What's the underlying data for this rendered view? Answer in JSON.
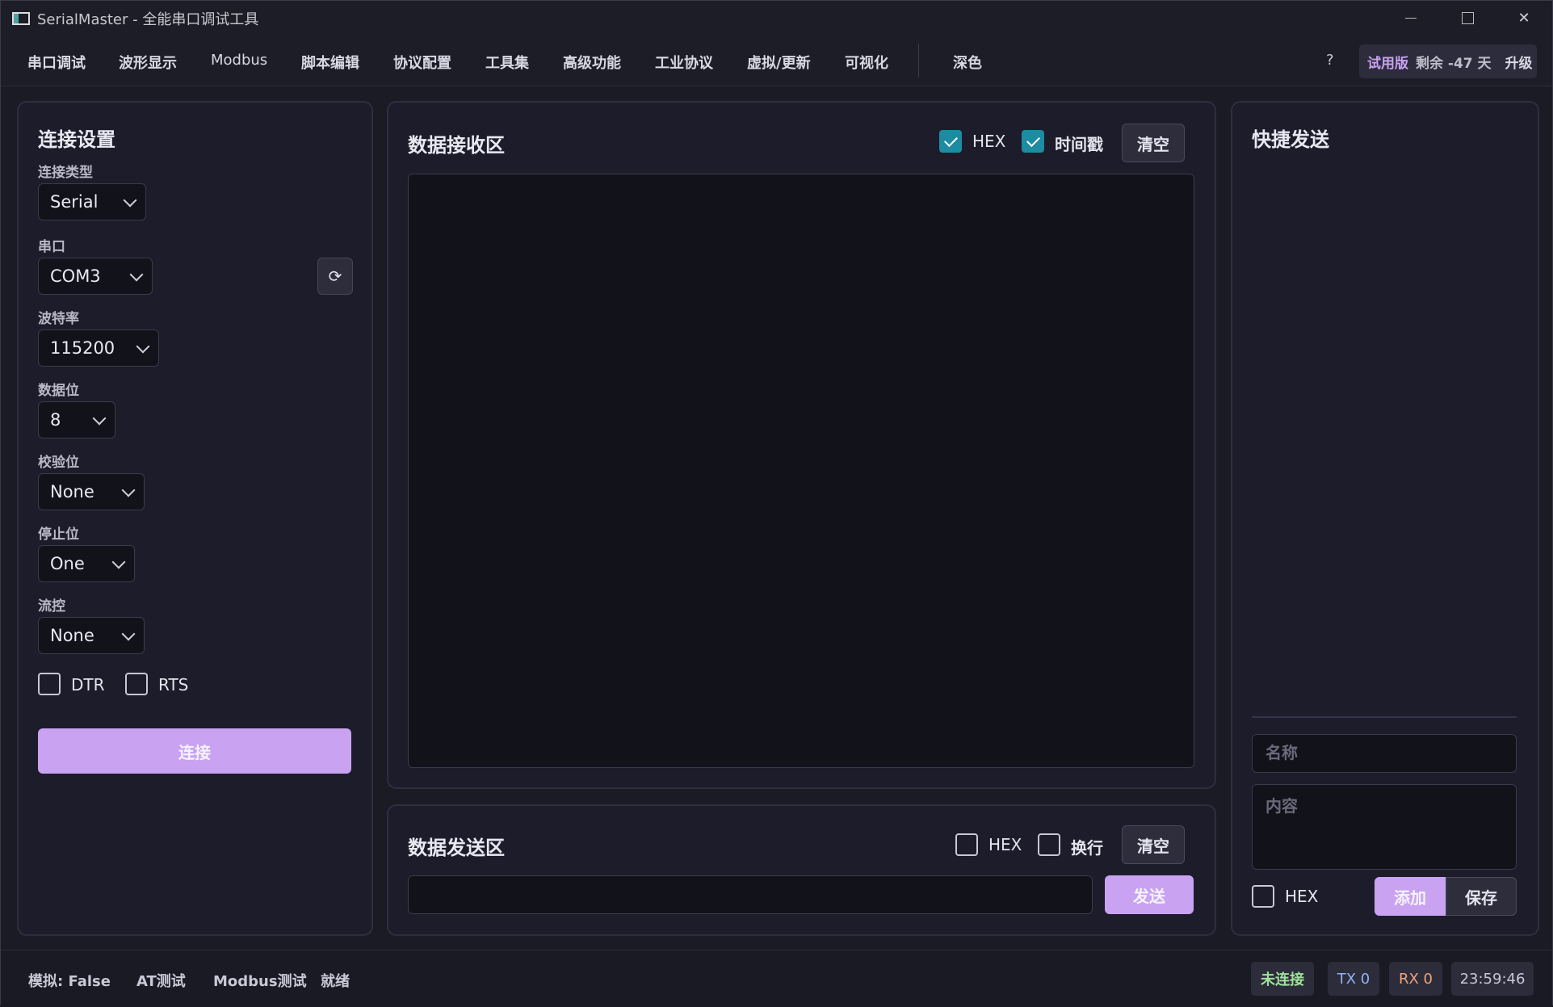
{
  "window": {
    "title": "SerialMaster - 全能串口调试工具"
  },
  "menu": {
    "items": [
      "串口调试",
      "波形显示",
      "Modbus",
      "脚本编辑",
      "协议配置",
      "工具集",
      "高级功能",
      "工业协议",
      "虚拟/更新",
      "可视化"
    ],
    "theme": "深色",
    "help": "?",
    "trial_label": "试用版",
    "trial_days": "剩余 -47 天",
    "upgrade": "升级"
  },
  "connection": {
    "title": "连接设置",
    "type_label": "连接类型",
    "type_value": "Serial",
    "port_label": "串口",
    "port_value": "COM3",
    "refresh_icon": "⟳",
    "baud_label": "波特率",
    "baud_value": "115200",
    "databits_label": "数据位",
    "databits_value": "8",
    "parity_label": "校验位",
    "parity_value": "None",
    "stopbits_label": "停止位",
    "stopbits_value": "One",
    "flow_label": "流控",
    "flow_value": "None",
    "dtr_label": "DTR",
    "rts_label": "RTS",
    "connect_label": "连接"
  },
  "receive": {
    "title": "数据接收区",
    "hex_label": "HEX",
    "hex_checked": true,
    "timestamp_label": "时间戳",
    "timestamp_checked": true,
    "clear_label": "清空"
  },
  "send": {
    "title": "数据发送区",
    "hex_label": "HEX",
    "newline_label": "换行",
    "clear_label": "清空",
    "send_label": "发送"
  },
  "quicksend": {
    "title": "快捷发送",
    "name_placeholder": "名称",
    "content_placeholder": "内容",
    "hex_label": "HEX",
    "add_label": "添加",
    "save_label": "保存"
  },
  "status": {
    "sim": "模拟: False",
    "at_test": "AT测试",
    "modbus_test": "Modbus测试",
    "ready": "就绪",
    "conn_state": "未连接",
    "tx": "TX 0",
    "rx": "RX 0",
    "time": "23:59:46"
  },
  "colors": {
    "accent": "#c9a2f2",
    "checkbox": "#1d8ca2",
    "disconnected": "#9de29a",
    "tx": "#8fb4f4",
    "rx": "#f2a27a"
  }
}
